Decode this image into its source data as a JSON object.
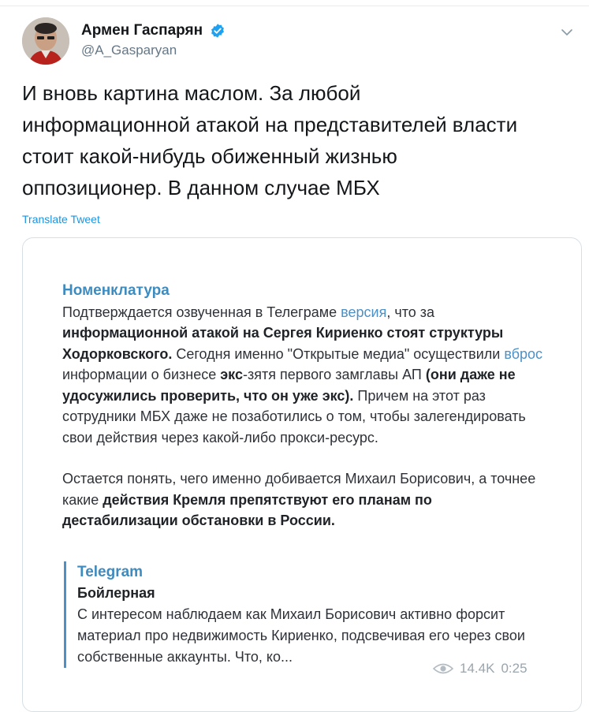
{
  "author": {
    "display_name": "Армен Гаспарян",
    "handle": "@A_Gasparyan"
  },
  "tweet": {
    "lines": [
      "И вновь картина маслом. За любой",
      "информационной атакой на представителей власти",
      "стоит какой-нибудь обиженный жизнью",
      "оппозиционер. В данном случае МБХ"
    ],
    "translate_label": "Translate Tweet"
  },
  "card": {
    "channel": "Номенклатура",
    "p1": {
      "t1": "Подтверждается озвученная в Телеграме ",
      "link1": "версия",
      "t2": ", что за ",
      "b1": "информационной атакой на Сергея Кириенко стоят структуры Ходорковского.",
      "t3": " Сегодня именно \"Открытые медиа\" осуществили ",
      "link2": "вброс",
      "t4": " информации о бизнесе ",
      "b2": "экс",
      "t5": "-зятя первого замглавы АП ",
      "b3": "(они даже не удосужились проверить, что он уже экс).",
      "t6": " Причем на этот раз сотрудники МБХ даже не позаботились о том, чтобы залегендировать свои действия через какой-либо прокси-ресурс."
    },
    "p2": {
      "t1": "Остается понять, чего именно добивается Михаил Борисович, а точнее какие ",
      "b1": "действия Кремля препятствуют его планам по дестабилизации обстановки в России."
    },
    "quote": {
      "source": "Telegram",
      "title": "Бойлерная",
      "text": "С интересом наблюдаем как Михаил Борисович активно форсит материал про недвижимость Кириенко, подсвечивая его через свои собственные аккаунты. Что, ко..."
    },
    "views": "14.4K",
    "time": "0:25"
  },
  "colors": {
    "link": "#1b95e0",
    "verified": "#1da1f2",
    "telegram_accent": "#4c90c5"
  }
}
